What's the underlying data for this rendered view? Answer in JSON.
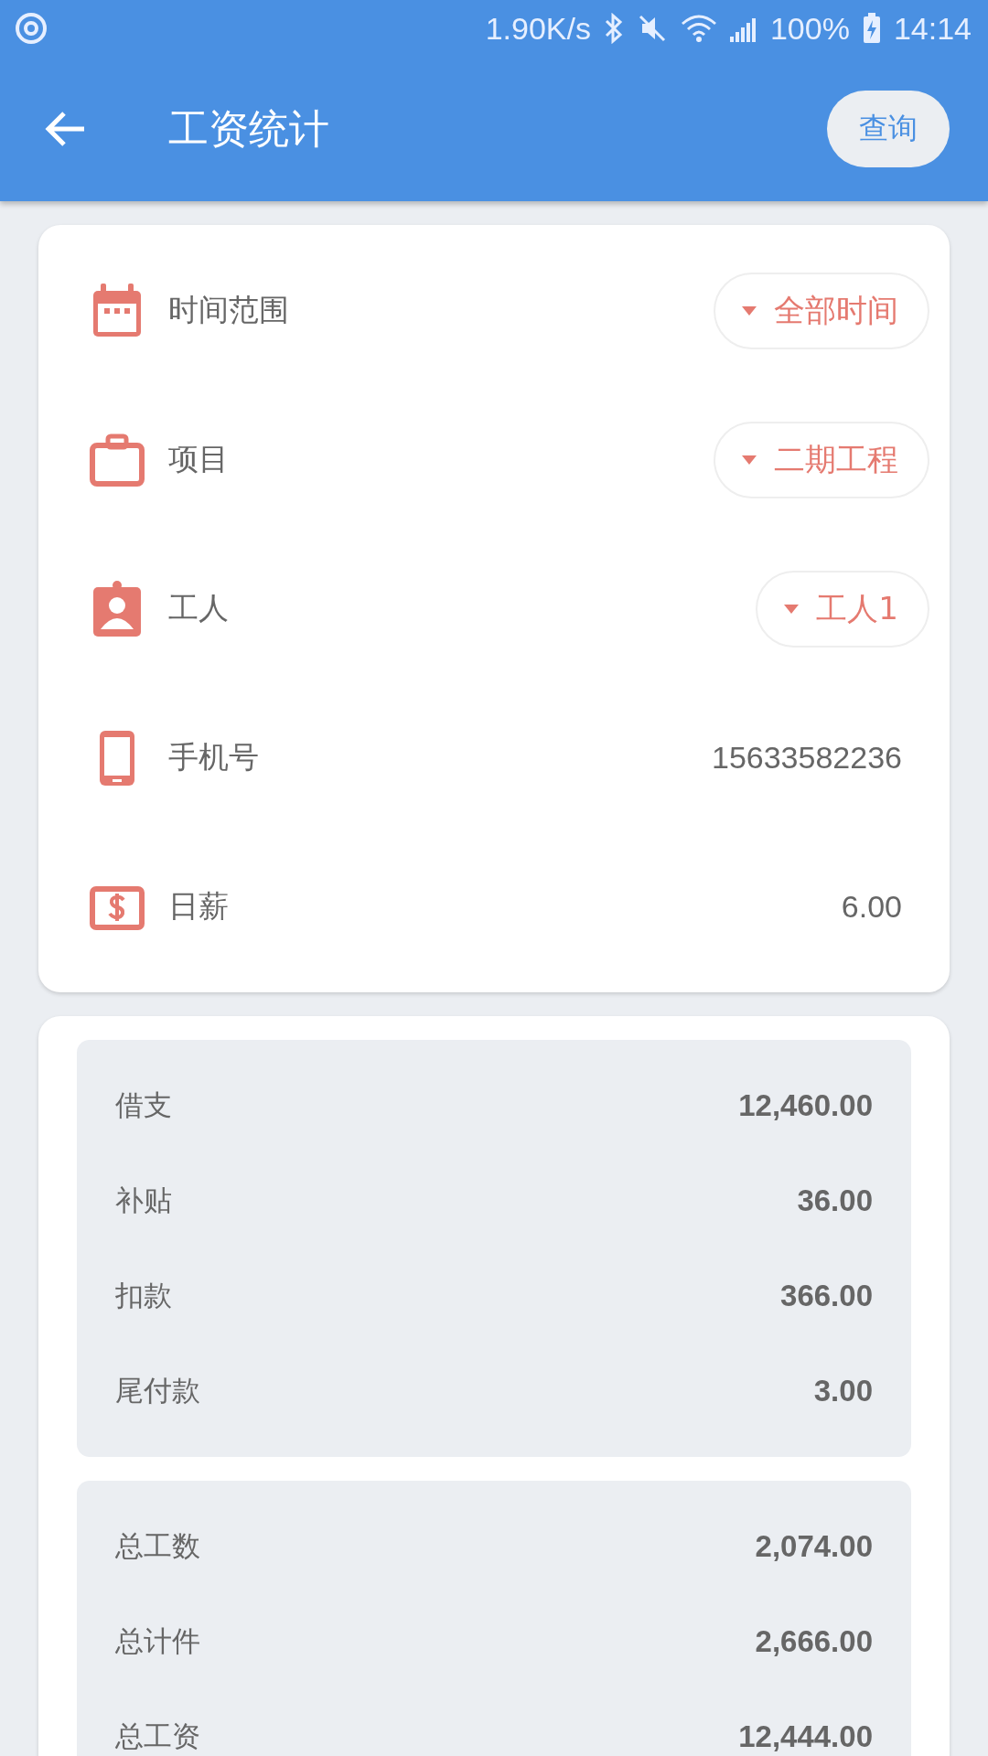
{
  "status_bar": {
    "speed": "1.90K/s",
    "battery": "100%",
    "time": "14:14"
  },
  "app_bar": {
    "title": "工资统计",
    "action": "查询"
  },
  "filters": [
    {
      "label": "时间范围",
      "kind": "dropdown",
      "value": "全部时间"
    },
    {
      "label": "项目",
      "kind": "dropdown",
      "value": "二期工程"
    },
    {
      "label": "工人",
      "kind": "dropdown",
      "value": "工人1"
    },
    {
      "label": "手机号",
      "kind": "text",
      "value": "15633582236"
    },
    {
      "label": "日薪",
      "kind": "text",
      "value": "6.00"
    }
  ],
  "stat_groups": [
    [
      {
        "label": "借支",
        "value": "12,460.00"
      },
      {
        "label": "补贴",
        "value": "36.00"
      },
      {
        "label": "扣款",
        "value": "366.00"
      },
      {
        "label": "尾付款",
        "value": "3.00"
      }
    ],
    [
      {
        "label": "总工数",
        "value": "2,074.00"
      },
      {
        "label": "总计件",
        "value": "2,666.00"
      },
      {
        "label": "总工资",
        "value": "12,444.00"
      }
    ]
  ]
}
